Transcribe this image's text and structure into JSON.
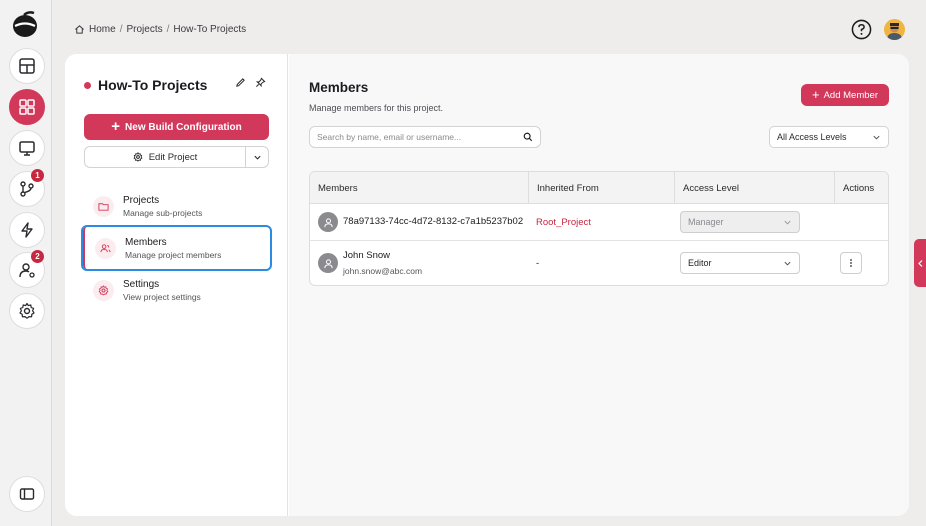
{
  "breadcrumb": {
    "home": "Home",
    "projects": "Projects",
    "current": "How-To Projects"
  },
  "rail": {
    "badge_git": "1",
    "badge_users": "2"
  },
  "project": {
    "title": "How-To Projects",
    "new_build_label": "New Build Configuration",
    "edit_label": "Edit Project"
  },
  "nav": [
    {
      "title": "Projects",
      "subtitle": "Manage sub-projects"
    },
    {
      "title": "Members",
      "subtitle": "Manage project members"
    },
    {
      "title": "Settings",
      "subtitle": "View project settings"
    }
  ],
  "members": {
    "title": "Members",
    "subtitle": "Manage members for this project.",
    "add_label": "Add Member",
    "search_placeholder": "Search by name, email or username...",
    "filter_value": "All Access Levels",
    "columns": [
      "Members",
      "Inherited From",
      "Access Level",
      "Actions"
    ],
    "rows": [
      {
        "name": "78a97133-74cc-4d72-8132-c7a1b5237b02",
        "email": "",
        "inherited": "Root_Project",
        "access": "Manager"
      },
      {
        "name": "John Snow",
        "email": "john.snow@abc.com",
        "inherited": "-",
        "access": "Editor"
      }
    ]
  },
  "colors": {
    "accent": "#d2385a",
    "selection": "#2a8be0"
  }
}
